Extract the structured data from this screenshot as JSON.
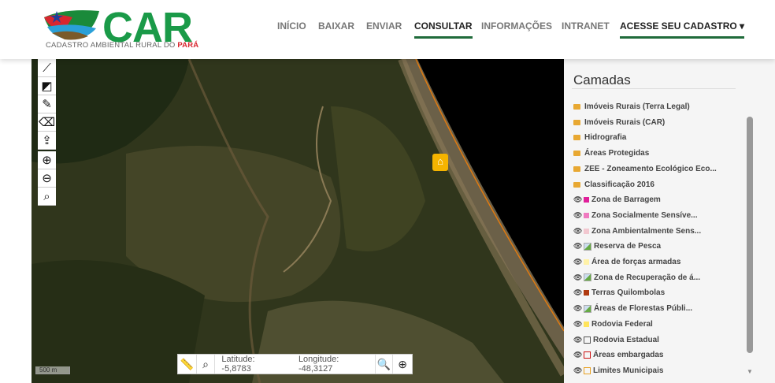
{
  "header": {
    "logo_text": "CAR",
    "logo_subtitle": "CADASTRO AMBIENTAL RURAL DO",
    "logo_subtitle_highlight": "PARÁ",
    "nav": [
      {
        "label": "INÍCIO"
      },
      {
        "label": "BAIXAR"
      },
      {
        "label": "ENVIAR"
      },
      {
        "label": "CONSULTAR",
        "active": true
      },
      {
        "label": "INFORMAÇÕES"
      },
      {
        "label": "INTRANET"
      },
      {
        "label": "ACESSE SEU CADASTRO ▾",
        "active": true
      }
    ]
  },
  "map": {
    "scale": "500 m",
    "latitude": "Latitude: -5,8783",
    "longitude": "Longitude: -48,3127"
  },
  "sidebar": {
    "title": "Camadas",
    "layers": [
      {
        "label": "Imóveis Rurais (Terra Legal)",
        "type": "folder"
      },
      {
        "label": "Imóveis Rurais (CAR)",
        "type": "folder"
      },
      {
        "label": "Hidrografia",
        "type": "folder"
      },
      {
        "label": "Áreas Protegidas",
        "type": "folder"
      },
      {
        "label": "ZEE - Zoneamento Ecológico Eco...",
        "type": "folder"
      },
      {
        "label": "Classificação 2016",
        "type": "folder"
      },
      {
        "label": "Zona de Barragem",
        "type": "layer",
        "color": "#e0209a"
      },
      {
        "label": "Zona Socialmente Sensíve...",
        "type": "layer",
        "color": "#f07ac0"
      },
      {
        "label": "Zona Ambientalmente Sens...",
        "type": "layer",
        "color": "#f2c8d0"
      },
      {
        "label": "Reserva de Pesca",
        "type": "broken"
      },
      {
        "label": "Área de forças armadas",
        "type": "layer",
        "color": "#fff2a8"
      },
      {
        "label": "Zona de Recuperação de á...",
        "type": "broken"
      },
      {
        "label": "Terras Quilombolas",
        "type": "layer",
        "color": "#b03a10"
      },
      {
        "label": "Áreas de Florestas Públi...",
        "type": "broken"
      },
      {
        "label": "Rodovia Federal",
        "type": "layer",
        "color": "#ffe45c"
      },
      {
        "label": "Rodovia Estadual",
        "type": "outline",
        "color": "#555555"
      },
      {
        "label": "Áreas embargadas",
        "type": "outline",
        "color": "#cc1111"
      },
      {
        "label": "Limites Municipais",
        "type": "outline",
        "color": "#e8a020"
      }
    ]
  }
}
